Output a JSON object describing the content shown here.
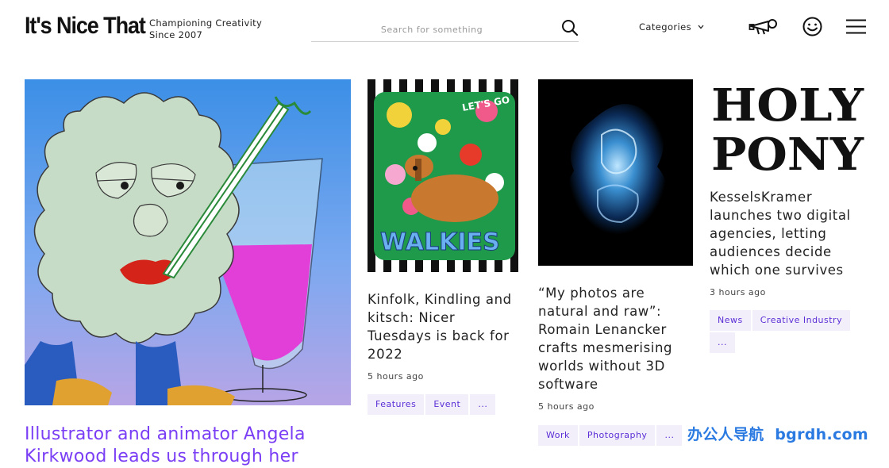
{
  "header": {
    "logo": "It's Nice That",
    "tagline_line1": "Championing Creativity",
    "tagline_line2": "Since 2007",
    "search_placeholder": "Search for something",
    "categories_label": "Categories"
  },
  "articles": [
    {
      "title": "Illustrator and animator Angela Kirkwood leads us through her"
    },
    {
      "title": "Kinfolk, Kindling and kitsch: Nicer Tuesdays is back for 2022",
      "time": "5 hours ago",
      "tags": [
        "Features",
        "Event",
        "..."
      ],
      "image_text": [
        "LET'S GO",
        "WALKIES"
      ]
    },
    {
      "title": "“My photos are natural and raw”: Romain Lenancker crafts mesmerising worlds without 3D software",
      "time": "5 hours ago",
      "tags": [
        "Work",
        "Photography",
        "..."
      ]
    },
    {
      "image_text": [
        "HOLY",
        "PONY"
      ],
      "title": "KesselsKramer launches two digital agencies, letting audiences decide which one survives",
      "time": "3 hours ago",
      "tags": [
        "News",
        "Creative Industry",
        "..."
      ]
    }
  ],
  "watermark": "办公人导航  bgrdh.com",
  "colors": {
    "accent": "#7a3ef5",
    "tag_bg": "#f2effb",
    "tag_text": "#5b2fd6"
  },
  "icons": [
    "search-icon",
    "chevron-down-icon",
    "megaphone-icon",
    "smiley-icon",
    "hamburger-icon"
  ]
}
